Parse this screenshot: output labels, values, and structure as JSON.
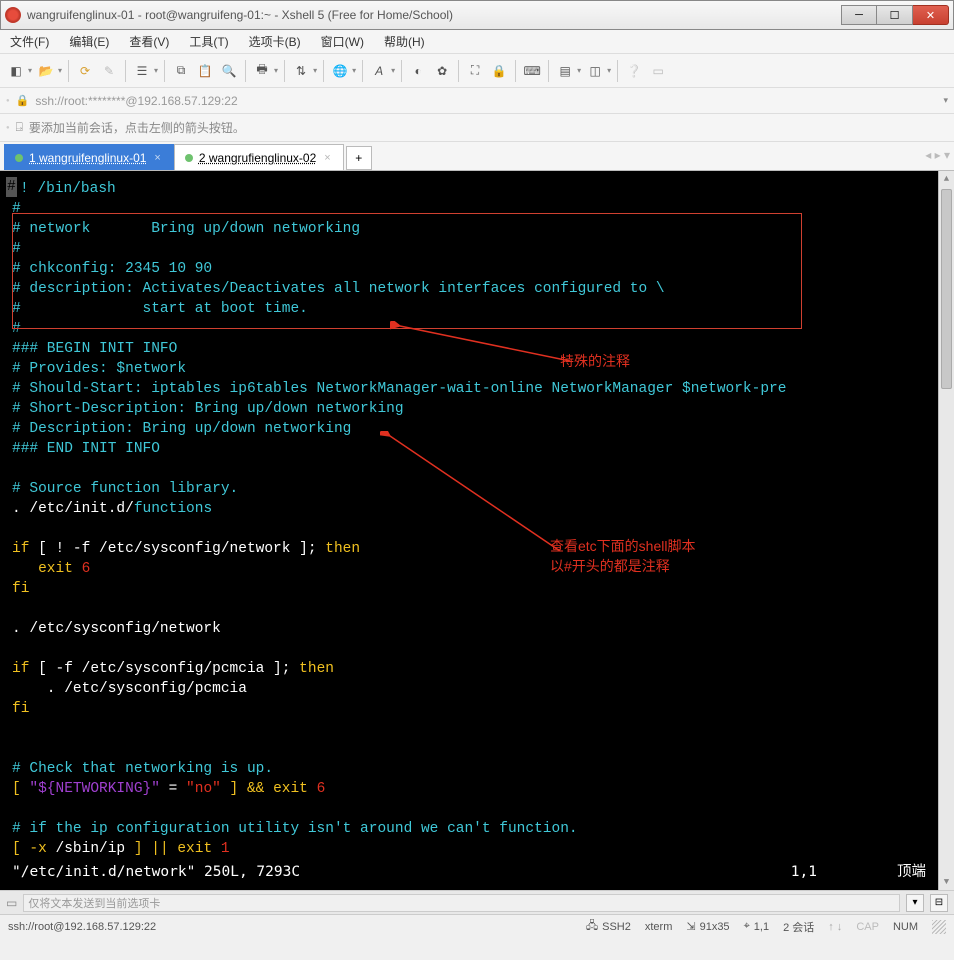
{
  "window": {
    "title": "wangruifenglinux-01 - root@wangruifeng-01:~ - Xshell 5 (Free for Home/School)"
  },
  "menu": {
    "file": "文件(F)",
    "edit": "编辑(E)",
    "view": "查看(V)",
    "tools": "工具(T)",
    "tabs": "选项卡(B)",
    "window": "窗口(W)",
    "help": "帮助(H)"
  },
  "addressbar": {
    "url": "ssh://root:********@192.168.57.129:22"
  },
  "hint": {
    "text": "要添加当前会话，点击左侧的箭头按钮。"
  },
  "tabs": {
    "tab1": "1 wangruifenglinux-01",
    "tab2": "2 wangrufienglinux-02",
    "add": "+"
  },
  "terminal": {
    "shebang_hash": "#",
    "shebang_line": "! /bin/bash",
    "c1": "#",
    "c2": "# network       Bring up/down networking",
    "c3": "#",
    "c4": "# chkconfig: 2345 10 90",
    "c5": "# description: Activates/Deactivates all network interfaces configured to \\",
    "c6": "#              start at boot time.",
    "c7": "#",
    "c8": "### BEGIN INIT INFO",
    "c9": "# Provides: $network",
    "c10": "# Should-Start: iptables ip6tables NetworkManager-wait-online NetworkManager $network-pre",
    "c11": "# Short-Description: Bring up/down networking",
    "c12": "# Description: Bring up/down networking",
    "c13": "### END INIT INFO",
    "comment_srcfunc": "# Source function library.",
    "dot1": ". ",
    "path_initd": "/etc/init.d/",
    "path_functions": "functions",
    "if1_a": "if",
    "if1_b": " [ ! -f ",
    "if1_c": "/etc/sysconfig/network",
    "if1_d": " ]; ",
    "if1_e": "then",
    "exit1_a": "   exit ",
    "exit1_b": "6",
    "fi1": "fi",
    "dot2": ". ",
    "path_sysnet": "/etc/sysconfig/network",
    "if2_a": "if",
    "if2_b": " [ -f ",
    "if2_c": "/etc/sysconfig/pcmcia",
    "if2_d": " ]; ",
    "if2_e": "then",
    "dot3": "    . ",
    "path_pcmcia": "/etc/sysconfig/pcmcia",
    "fi2": "fi",
    "check_comment": "# Check that networking is up.",
    "net1": "[ ",
    "net2": "\"${NETWORKING}\"",
    "net3": " = ",
    "net4": "\"no\"",
    "net5": " ] && ",
    "net6": "exit",
    "net7": " 6",
    "ip_comment": "# if the ip configuration utility isn't around we can't function.",
    "ip1": "[ -x ",
    "ip2": "/sbin/ip",
    "ip3": " ] || ",
    "ip4": "exit",
    "ip5": " 1",
    "statusline": "\"/etc/init.d/network\" 250L, 7293C",
    "status_pos": "1,1",
    "status_top": "顶端"
  },
  "annotations": {
    "a1": "特殊的注释",
    "a2": "查看etc下面的shell脚本\n以#开头的都是注释"
  },
  "bottominput": {
    "placeholder": "仅将文本发送到当前选项卡"
  },
  "statusbar": {
    "conn": "ssh://root@192.168.57.129:22",
    "ssh": "SSH2",
    "term": "xterm",
    "size": "91x35",
    "pos": "1,1",
    "sessions": "2 会话",
    "cap": "CAP",
    "num": "NUM"
  }
}
